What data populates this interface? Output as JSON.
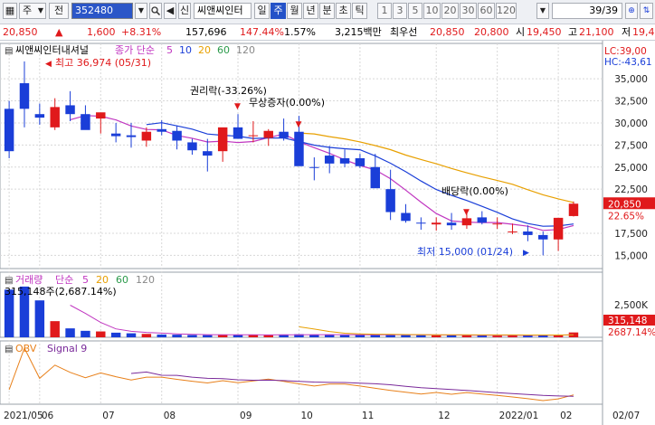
{
  "toolbar": {
    "market": "주",
    "mode": "전",
    "code": "352480",
    "type_badge": "신",
    "stock_name": "씨앤씨인터",
    "periods": [
      "일",
      "주",
      "월",
      "년",
      "분",
      "초",
      "틱"
    ],
    "active_period": "주",
    "intervals": [
      "1",
      "3",
      "5",
      "10",
      "20",
      "30",
      "60",
      "120"
    ],
    "page": "39/39"
  },
  "quote": {
    "price": "20,850",
    "change": "1,600",
    "change_pct": "+8.31%",
    "volume": "157,696",
    "volume_ratio": "147.44%",
    "turnover_pct": "1.57%",
    "amount": "3,215백만",
    "best_ask_label": "최우선",
    "best_ask": "20,850",
    "best_bid": "20,800",
    "open_label": "시",
    "open": "19,450",
    "high_label": "고",
    "high": "21,100",
    "low_label": "저",
    "low": "19,4"
  },
  "price_panel": {
    "title": "씨앤씨인터내셔널",
    "ma_label": "종가 단순",
    "ma_periods": [
      "5",
      "10",
      "20",
      "60",
      "120"
    ],
    "lc": "LC:39,00",
    "hc": "HC:-43,61",
    "y_ticks": [
      "35,000",
      "32,500",
      "30,000",
      "27,500",
      "25,000",
      "22,500",
      "17,500",
      "15,000"
    ],
    "price_tag": "20,850",
    "pct_tag": "22.65%",
    "annotations": {
      "high": "최고 36,974 (05/31)",
      "low": "최저 15,000 (01/24)",
      "rights": "권리락(-33.26%)",
      "bonus": "무상증자(0.00%)",
      "dividend": "배당락(0.00%)"
    }
  },
  "volume_panel": {
    "title": "거래량",
    "ma_label": "단순",
    "ma_periods": [
      "5",
      "20",
      "60",
      "120"
    ],
    "info": "315,148주(2,687.14%)",
    "y_tick": "2,500K",
    "vol_tag": "315,148",
    "pct_tag": "2687.14%"
  },
  "obv_panel": {
    "title": "OBV",
    "signal": "Signal 9"
  },
  "x_axis": [
    "2021/05",
    "06",
    "07",
    "08",
    "09",
    "10",
    "11",
    "12",
    "2022/01",
    "02",
    "02/07"
  ],
  "colors": {
    "up": "#e0191b",
    "down": "#1a3ed8",
    "ma5": "#c036c0",
    "ma10": "#1a3ed8",
    "ma20": "#e8a000",
    "grid": "#d8d8d8",
    "tag_bg": "#e0191b"
  },
  "chart_data": {
    "type": "candlestick",
    "interval": "weekly",
    "x": [
      "2021-05-24",
      "2021-05-31",
      "2021-06-07",
      "2021-06-14",
      "2021-06-21",
      "2021-06-28",
      "2021-07-05",
      "2021-07-12",
      "2021-07-19",
      "2021-07-26",
      "2021-08-02",
      "2021-08-09",
      "2021-08-16",
      "2021-08-23",
      "2021-08-30",
      "2021-09-06",
      "2021-09-13",
      "2021-09-20",
      "2021-09-27",
      "2021-10-04",
      "2021-10-11",
      "2021-10-18",
      "2021-10-25",
      "2021-11-01",
      "2021-11-08",
      "2021-11-15",
      "2021-11-22",
      "2021-11-29",
      "2021-12-06",
      "2021-12-13",
      "2021-12-20",
      "2021-12-27",
      "2022-01-03",
      "2022-01-10",
      "2022-01-17",
      "2022-01-24",
      "2022-01-31",
      "2022-02-07"
    ],
    "open": [
      31600,
      34500,
      31000,
      29500,
      32000,
      31000,
      30500,
      28800,
      28600,
      28000,
      29300,
      29100,
      27800,
      26800,
      26800,
      29500,
      28500,
      28300,
      29000,
      29000,
      25000,
      26300,
      26000,
      26000,
      25000,
      22500,
      19800,
      18700,
      18500,
      18700,
      18400,
      19300,
      18600,
      17700,
      17700,
      17300,
      16800,
      19450
    ],
    "high": [
      32500,
      36974,
      32200,
      32800,
      33600,
      32000,
      31000,
      30000,
      30000,
      29500,
      30300,
      29700,
      28200,
      28200,
      27700,
      31000,
      30200,
      29300,
      30500,
      30800,
      26100,
      27400,
      27000,
      26500,
      26500,
      24700,
      20800,
      19300,
      19300,
      19800,
      19800,
      20000,
      19300,
      18600,
      18400,
      17700,
      18700,
      21100
    ],
    "low": [
      26000,
      29500,
      29800,
      29200,
      30200,
      29500,
      28800,
      27800,
      27200,
      27300,
      28600,
      27000,
      26400,
      24500,
      25600,
      28500,
      27800,
      27400,
      28000,
      28500,
      23500,
      24300,
      25000,
      24900,
      22800,
      19000,
      18700,
      17900,
      17800,
      17900,
      18000,
      18500,
      18000,
      17400,
      16600,
      15000,
      15500,
      19400
    ],
    "close": [
      26800,
      31600,
      30600,
      31800,
      31000,
      29200,
      31200,
      28500,
      28400,
      29000,
      29000,
      28000,
      26900,
      26300,
      29500,
      28200,
      28600,
      29100,
      28300,
      25100,
      24900,
      25400,
      25400,
      25100,
      22600,
      19900,
      18900,
      18600,
      18700,
      18400,
      19200,
      18700,
      18600,
      17700,
      17300,
      16800,
      19250,
      20850
    ],
    "volume": [
      3100000,
      3300000,
      2400000,
      1050000,
      580000,
      420000,
      380000,
      300000,
      260000,
      220000,
      180000,
      170000,
      150000,
      140000,
      180000,
      160000,
      150000,
      140000,
      180000,
      200000,
      170000,
      150000,
      140000,
      150000,
      180000,
      170000,
      150000,
      140000,
      130000,
      150000,
      140000,
      120000,
      110000,
      120000,
      140000,
      150000,
      140000,
      315148
    ],
    "ylim": [
      13500,
      38500
    ],
    "volume_ylim": [
      0,
      4000000
    ]
  }
}
